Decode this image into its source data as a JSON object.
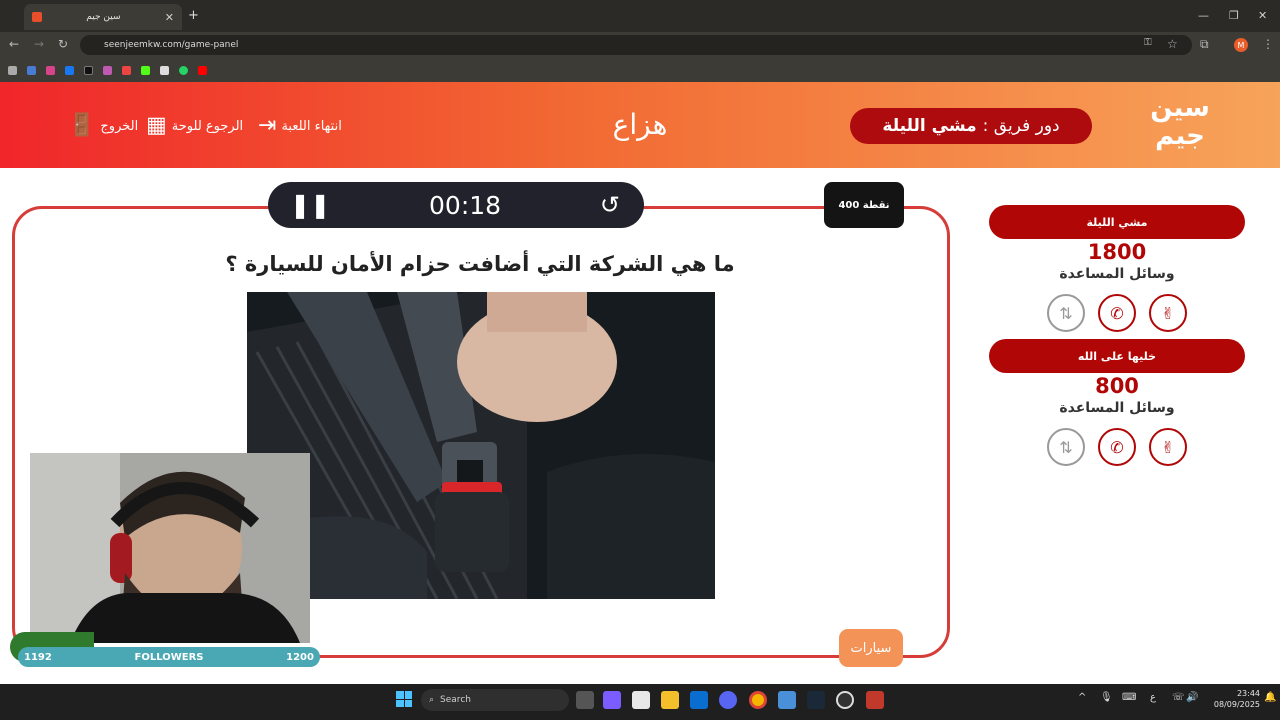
{
  "browser": {
    "tab_title": "سين جيم",
    "url": "seenjeemkw.com/game-panel",
    "profile_initial": "M"
  },
  "header": {
    "logo_line1": "سين",
    "logo_line2": "جيم",
    "turn_prefix": "دور فريق :",
    "turn_team": "مشي الليلة",
    "category_title": "هزاع",
    "end_game_label": "انتهاء اللعبة",
    "back_to_board_label": "الرجوع للوحة",
    "exit_label": "الخروج"
  },
  "question": {
    "timer": "00:18",
    "points": "400 نقطة",
    "text": "ما هي الشركة التي أضافت حزام الأمان للسيارة ؟",
    "category_tag": "سيارات"
  },
  "teams": [
    {
      "name": "مشي الليلة",
      "score": "1800",
      "aids_label": "وسائل المساعدة"
    },
    {
      "name": "خليها على الله",
      "score": "800",
      "aids_label": "وسائل المساعدة"
    }
  ],
  "overlay": {
    "followers_current": "1192",
    "followers_label": "FOLLOWERS",
    "followers_goal": "1200"
  },
  "taskbar": {
    "search_placeholder": "Search",
    "time": "23:44",
    "date": "08/09/2025"
  },
  "colors": {
    "header_start": "#f0262a",
    "header_end": "#f7a35a",
    "accent_red": "#b10606",
    "card_border": "#d63d38",
    "timer_bg": "#21222c"
  }
}
